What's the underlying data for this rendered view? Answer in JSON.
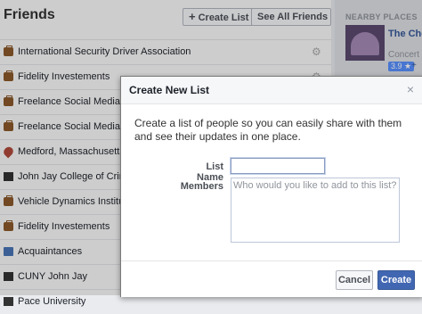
{
  "header": {
    "title": "Friends",
    "create_list_label": "Create List",
    "see_all_label": "See All Friends"
  },
  "lists": [
    {
      "label": "International Security Driver Association",
      "icon": "briefcase-icon"
    },
    {
      "label": "Fidelity Investements",
      "icon": "briefcase-icon"
    },
    {
      "label": "Freelance Social Media and",
      "icon": "briefcase-icon"
    },
    {
      "label": "Freelance Social Media and",
      "icon": "briefcase-icon"
    },
    {
      "label": "Medford, Massachusetts Are",
      "icon": "map-pin-icon"
    },
    {
      "label": "John Jay College of Criminal",
      "icon": "graduation-cap-icon"
    },
    {
      "label": "Vehicle Dynamics Institute",
      "icon": "briefcase-icon"
    },
    {
      "label": "Fidelity Investements",
      "icon": "briefcase-icon"
    },
    {
      "label": "Acquaintances",
      "icon": "group-icon"
    },
    {
      "label": "CUNY John Jay",
      "icon": "graduation-cap-icon"
    },
    {
      "label": "Pace University",
      "icon": "graduation-cap-icon"
    }
  ],
  "nearby": {
    "heading": "NEARBY PLACES",
    "place_name": "The Chev Events",
    "place_sub": "Concert V",
    "rating": "3.9 ★",
    "add_label": "+"
  },
  "dialog": {
    "title": "Create New List",
    "close_glyph": "×",
    "description": "Create a list of people so you can easily share with them and see their updates in one place.",
    "list_name_label": "List Name",
    "list_name_value": "",
    "members_label": "Members",
    "members_placeholder": "Who would you like to add to this list?",
    "cancel_label": "Cancel",
    "create_label": "Create"
  },
  "colors": {
    "primary": "#4267b2",
    "link": "#365899"
  }
}
